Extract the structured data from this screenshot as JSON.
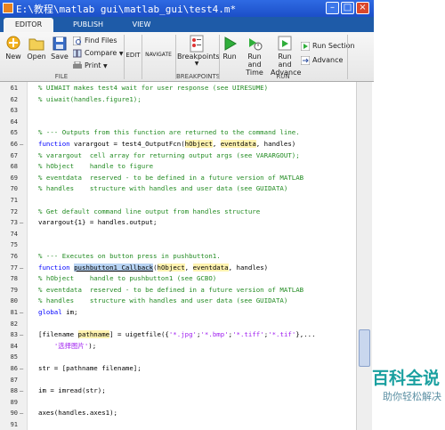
{
  "window": {
    "title": "E:\\教程\\matlab gui\\matlab_gui\\test4.m*"
  },
  "tabs": [
    {
      "label": "EDITOR"
    },
    {
      "label": "PUBLISH"
    },
    {
      "label": "VIEW"
    }
  ],
  "ribbon": {
    "file": {
      "group_label": "FILE",
      "new_label": "New",
      "open_label": "Open",
      "save_label": "Save",
      "find_files_label": "Find Files",
      "compare_label": "Compare",
      "print_label": "Print"
    },
    "edit": {
      "label": "EDIT"
    },
    "navigate": {
      "label": "NAVIGATE"
    },
    "breakpoints": {
      "group_label": "BREAKPOINTS",
      "button_label": "Breakpoints"
    },
    "run": {
      "group_label": "RUN",
      "run_label": "Run",
      "run_time_label1": "Run and",
      "run_time_label2": "Time",
      "run_advance_label1": "Run and",
      "run_advance_label2": "Advance",
      "run_section_label": "Run Section",
      "advance_label": "Advance"
    }
  },
  "code_lines": [
    {
      "num": "61",
      "mark": "",
      "t": "% UIWAIT makes test4 wait for user response (see UIRESUME)"
    },
    {
      "num": "62",
      "mark": "",
      "t": "% uiwait(handles.figure1);"
    },
    {
      "num": "63",
      "mark": "",
      "t": ""
    },
    {
      "num": "64",
      "mark": "",
      "t": ""
    },
    {
      "num": "65",
      "mark": "",
      "t": "% --- Outputs from this function are returned to the command line."
    },
    {
      "num": "66",
      "mark": "–",
      "t": "function varargout = test4_OutputFcn(hObject, eventdata, handles)"
    },
    {
      "num": "67",
      "mark": "",
      "t": "% varargout  cell array for returning output args (see VARARGOUT);"
    },
    {
      "num": "68",
      "mark": "",
      "t": "% hObject    handle to figure"
    },
    {
      "num": "69",
      "mark": "",
      "t": "% eventdata  reserved - to be defined in a future version of MATLAB"
    },
    {
      "num": "70",
      "mark": "",
      "t": "% handles    structure with handles and user data (see GUIDATA)"
    },
    {
      "num": "71",
      "mark": "",
      "t": ""
    },
    {
      "num": "72",
      "mark": "",
      "t": "% Get default command line output from handles structure"
    },
    {
      "num": "73",
      "mark": "–",
      "t": "varargout{1} = handles.output;"
    },
    {
      "num": "74",
      "mark": "",
      "t": ""
    },
    {
      "num": "75",
      "mark": "",
      "t": ""
    },
    {
      "num": "76",
      "mark": "",
      "t": "% --- Executes on button press in pushbutton1."
    },
    {
      "num": "77",
      "mark": "–",
      "t": "function pushbutton1_Callback(hObject, eventdata, handles)"
    },
    {
      "num": "78",
      "mark": "",
      "t": "% hObject    handle to pushbutton1 (see GCBO)"
    },
    {
      "num": "79",
      "mark": "",
      "t": "% eventdata  reserved - to be defined in a future version of MATLAB"
    },
    {
      "num": "80",
      "mark": "",
      "t": "% handles    structure with handles and user data (see GUIDATA)"
    },
    {
      "num": "81",
      "mark": "–",
      "t": "global im;"
    },
    {
      "num": "82",
      "mark": "",
      "t": ""
    },
    {
      "num": "83",
      "mark": "–",
      "t": "[filename pathname] = uigetfile({'*.jpg';'*.bmp';'*.tiff';'*.tif'},..."
    },
    {
      "num": "84",
      "mark": "",
      "t": "    '选择图片');"
    },
    {
      "num": "85",
      "mark": "",
      "t": ""
    },
    {
      "num": "86",
      "mark": "–",
      "t": "str = [pathname filename];"
    },
    {
      "num": "87",
      "mark": "",
      "t": ""
    },
    {
      "num": "88",
      "mark": "–",
      "t": "im = imread(str);"
    },
    {
      "num": "89",
      "mark": "",
      "t": ""
    },
    {
      "num": "90",
      "mark": "–",
      "t": "axes(handles.axes1);"
    },
    {
      "num": "91",
      "mark": "",
      "t": ""
    }
  ],
  "watermark": {
    "title": "百科全说",
    "subtitle": "助你轻松解决"
  },
  "colors": {
    "titlebar": "#1c4fc8",
    "tabstrip": "#1e5ba8",
    "comment": "#228b22",
    "keyword": "#0000ff",
    "string": "#a020f0"
  }
}
